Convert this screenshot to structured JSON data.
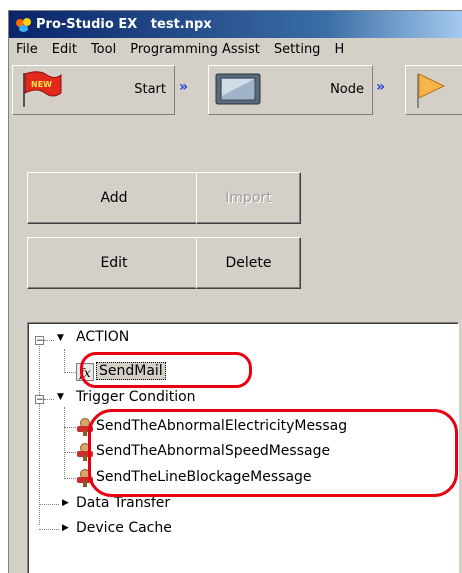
{
  "window": {
    "title": "Pro-Studio EX   test.npx"
  },
  "menu": [
    "File",
    "Edit",
    "Tool",
    "Programming Assist",
    "Setting",
    "H"
  ],
  "wizard": {
    "start": {
      "label": "Start",
      "badge": "NEW"
    },
    "separator": "»",
    "node": {
      "label": "Node"
    }
  },
  "buttons": {
    "add": "Add",
    "import": "Import",
    "edit": "Edit",
    "delete": "Delete"
  },
  "tree": {
    "action": {
      "label": "ACTION",
      "expander": "−",
      "children": [
        {
          "label": "SendMail",
          "icon": "fx-function-icon",
          "icon_text": "fx",
          "selected": true
        }
      ]
    },
    "trigger": {
      "label": "Trigger Condition",
      "expander": "−",
      "children": [
        {
          "label": "SendTheAbnormalElectricityMessag",
          "icon": "trigger-message-icon"
        },
        {
          "label": "SendTheAbnormalSpeedMessage",
          "icon": "trigger-message-icon"
        },
        {
          "label": "SendTheLineBlockageMessage",
          "icon": "trigger-message-icon"
        }
      ]
    },
    "data_transfer": {
      "label": "Data Transfer"
    },
    "device_cache": {
      "label": "Device Cache"
    }
  },
  "colors": {
    "titlebar": "#0a246a",
    "highlight": "#e60012",
    "chevron": "#1f3fe0",
    "face": "#d4d0c8"
  }
}
